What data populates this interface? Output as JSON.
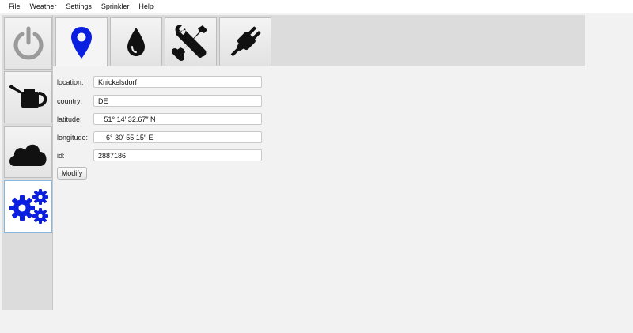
{
  "menubar": {
    "items": [
      "File",
      "Weather",
      "Settings",
      "Sprinkler",
      "Help"
    ]
  },
  "sidebar": {
    "tabs": [
      {
        "icon": "power-icon",
        "selected": false
      },
      {
        "icon": "watering-can-icon",
        "selected": false
      },
      {
        "icon": "cloud-icon",
        "selected": false
      },
      {
        "icon": "gears-icon",
        "selected": true
      }
    ]
  },
  "top_tabs": [
    {
      "icon": "location-pin-icon",
      "selected": true
    },
    {
      "icon": "water-drop-icon",
      "selected": false
    },
    {
      "icon": "tools-icon",
      "selected": false
    },
    {
      "icon": "plug-icon",
      "selected": false
    }
  ],
  "form": {
    "location": {
      "label": "location:",
      "value": "Knickelsdorf"
    },
    "country": {
      "label": "country:",
      "value": "DE"
    },
    "latitude": {
      "label": "latitude:",
      "value": "   51° 14′ 32.67″ N"
    },
    "longitude": {
      "label": "longitude:",
      "value": "    6° 30′ 55.15″ E"
    },
    "id": {
      "label": "id:",
      "value": "2887186"
    }
  },
  "modify_button_label": "Modify",
  "colors": {
    "accent_blue": "#0a1fe0",
    "icon_dark": "#111111",
    "power_gray": "#9a9a9a"
  }
}
